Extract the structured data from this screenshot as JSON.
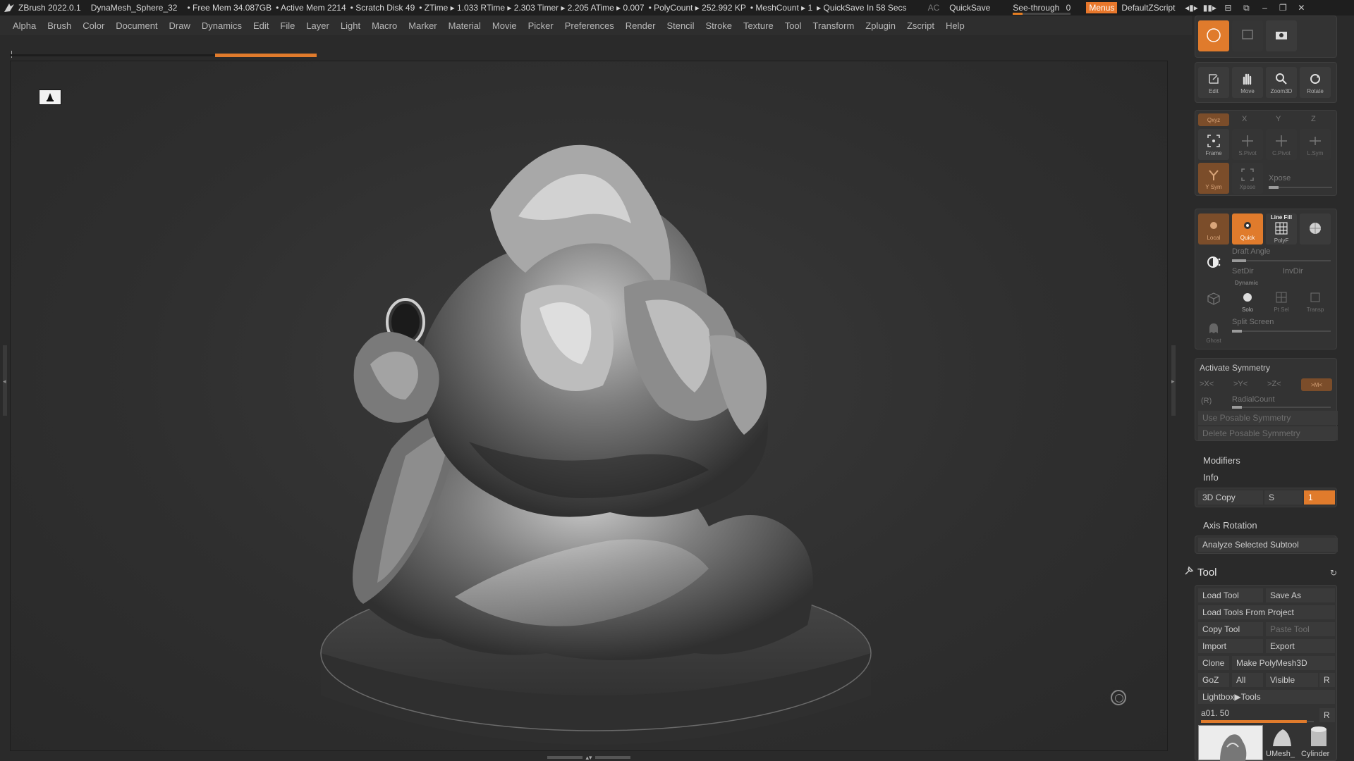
{
  "titlebar": {
    "app": "ZBrush 2022.0.1",
    "document": "DynaMesh_Sphere_32",
    "free_mem": "• Free Mem 34.087GB",
    "active_mem": "• Active Mem 2214",
    "scratch": "• Scratch Disk 49",
    "ztime": "• ZTime ▸ 1.033 RTime ▸ 2.303 Timer ▸ 2.205 ATime ▸ 0.007",
    "polycount": "• PolyCount ▸ 252.992 KP",
    "meshcount": "• MeshCount ▸ 1",
    "quicksave_status": "▸ QuickSave In 58 Secs",
    "ac": "AC",
    "quicksave": "QuickSave",
    "see_through_label": "See-through",
    "see_through_value": "0",
    "menus": "Menus",
    "script": "DefaultZScript"
  },
  "menubar": [
    "Alpha",
    "Brush",
    "Color",
    "Document",
    "Draw",
    "Dynamics",
    "Edit",
    "File",
    "Layer",
    "Light",
    "Macro",
    "Marker",
    "Material",
    "Movie",
    "Picker",
    "Preferences",
    "Render",
    "Stencil",
    "Stroke",
    "Texture",
    "Tool",
    "Transform",
    "Zplugin",
    "Zscript",
    "Help"
  ],
  "accent_color": "#e07b2c",
  "rpanel": {
    "nav_buttons": [
      "Edit",
      "Move",
      "Zoom3D",
      "Rotate"
    ],
    "axis_labels": [
      "Qxyz",
      "X",
      "Y",
      "Z"
    ],
    "frame_buttons": [
      "Frame",
      "S.Pivot",
      "C.Pivot",
      "L.Sym"
    ],
    "ysym": "Y Sym",
    "xpose_icon": "Xpose",
    "xpose_label": "Xpose",
    "local": "Local",
    "quick": "Quick",
    "linefill": "Line Fill",
    "polyf": "PolyF",
    "draft_angle": "Draft Angle",
    "setdir": "SetDir",
    "invdir": "InvDir",
    "dynamic": "Dynamic",
    "solo": "Solo",
    "ptsel": "Pt Sel",
    "transp": "Transp",
    "ghost": "Ghost",
    "split_screen": "Split Screen",
    "activate_symmetry": "Activate Symmetry",
    "sym_axes": [
      ">X<",
      ">Y<",
      ">Z<",
      ">M<"
    ],
    "r_label": "(R)",
    "radial_count": "RadialCount",
    "use_posable": "Use Posable Symmetry",
    "delete_posable": "Delete Posable Symmetry",
    "modifiers": "Modifiers",
    "info": "Info",
    "copy3d": "3D Copy",
    "s_label": "S",
    "s_value": "1",
    "axis_rotation": "Axis Rotation",
    "analyze": "Analyze Selected Subtool",
    "tool_header": "Tool",
    "load_tool": "Load Tool",
    "save_as": "Save As",
    "load_tools_project": "Load Tools From Project",
    "copy_tool": "Copy Tool",
    "paste_tool": "Paste Tool",
    "import": "Import",
    "export": "Export",
    "clone": "Clone",
    "make_polymesh": "Make PolyMesh3D",
    "goz": "GoZ",
    "all": "All",
    "visible": "Visible",
    "r": "R",
    "lightbox_tools": "Lightbox▶Tools",
    "tool_name": "a01. 50",
    "thumb_umesh": "UMesh_",
    "thumb_cylinder": "Cylinder"
  }
}
